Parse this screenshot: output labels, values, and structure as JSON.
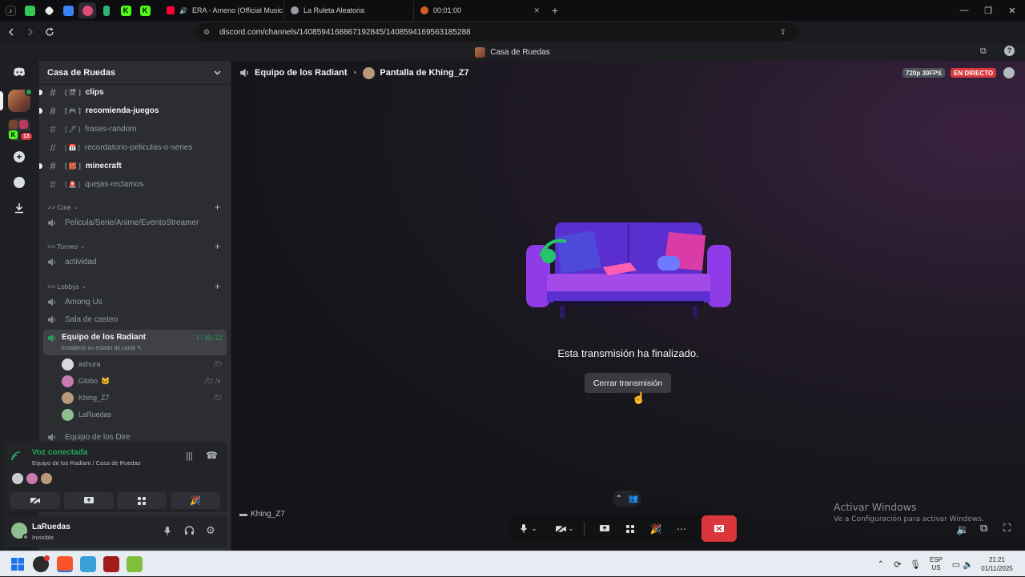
{
  "browser": {
    "tabs": [
      {
        "label": "ERA - Ameno (Official Music Vide",
        "color": "#ff0033"
      },
      {
        "label": "La Ruleta Aleatoria",
        "color": "#8a8a8a"
      },
      {
        "label": "00:01:00",
        "color": "#d65c2a"
      }
    ],
    "url": "discord.com/channels/1408594168867192845/1408594169563185288",
    "extension_badge": "1"
  },
  "discord": {
    "window_title": "Casa de Ruedas",
    "rail": {
      "mention_badge": "13"
    },
    "server": {
      "name": "Casa de Ruedas",
      "text_channels": [
        {
          "name": "clips",
          "unread": true
        },
        {
          "name": "recomienda-juegos",
          "unread": true
        },
        {
          "name": "frases-random",
          "unread": false
        },
        {
          "name": "recordatorio-peliculas-o-series",
          "unread": false
        },
        {
          "name": "minecraft",
          "unread": true
        },
        {
          "name": "quejas-reclamos",
          "unread": false
        }
      ],
      "categories": [
        {
          "name": ">> Cine",
          "channels": [
            "Pelicula/Serie/Anime/EventoStreamer"
          ]
        },
        {
          "name": ">> Torneo",
          "channels": [
            "actividad"
          ]
        },
        {
          "name": ">> Lobbys",
          "channels": [
            "Among Us",
            "Sala de casteo"
          ]
        }
      ],
      "active_voice": {
        "name": "Equipo de los Radiant",
        "timer": "1:30:22",
        "status_hint": "Establece un estado de canal",
        "members": [
          {
            "name": "ashura",
            "emoji": ""
          },
          {
            "name": "Globo",
            "emoji": "🐱"
          },
          {
            "name": "Khing_Z7",
            "emoji": ""
          },
          {
            "name": "LaRuedas",
            "emoji": ""
          }
        ]
      },
      "next_voice": "Equipo de los Dire"
    },
    "voice_panel": {
      "status": "Voz conectada",
      "location": "Equipo de los Radiant / Casa de Ruedas"
    },
    "user": {
      "name": "LaRuedas",
      "status": "Invisible"
    },
    "stage": {
      "channel": "Equipo de los Radiant",
      "stream_title": "Pantalla de Khing_Z7",
      "quality": "720p 30FPS",
      "live_label": "EN DIRECTO",
      "end_message": "Esta transmisión ha finalizado.",
      "close_button": "Cerrar transmisión",
      "streamer_tag": "Khing_Z7"
    }
  },
  "watermark": {
    "title": "Activar Windows",
    "subtitle": "Ve a Configuración para activar Windows."
  },
  "taskbar": {
    "lang": "ESP",
    "region": "US",
    "time": "21:21",
    "date": "01/11/2025"
  }
}
